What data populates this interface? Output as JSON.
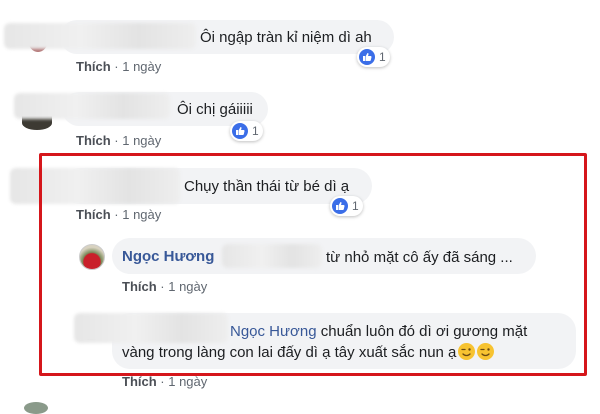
{
  "comments": [
    {
      "text": "Ôi ngập tràn kỉ niệm dì ah",
      "like_label": "Thích",
      "time": "1 ngày",
      "reactions": "1"
    },
    {
      "text": "Ôi chị gáiiiii",
      "like_label": "Thích",
      "time": "1 ngày",
      "reactions": "1"
    },
    {
      "text": "Chụy thần thái từ bé dì ạ",
      "like_label": "Thích",
      "time": "1 ngày",
      "reactions": "1"
    }
  ],
  "reply1": {
    "name": "Ngọc Hương",
    "text": "từ nhỏ mặt cô ấy đã sáng ...",
    "like_label": "Thích",
    "time": "1 ngày"
  },
  "reply2": {
    "mention": "Ngọc Hương",
    "text_line1": " chuẩn luôn đó dì ơi gương mặt",
    "text_line2": "vàng trong làng con lai đấy dì ạ tây xuất sắc nun ạ",
    "like_label": "Thích",
    "time": "1 ngày"
  },
  "colors": {
    "highlight": "#d5161b",
    "link": "#385898",
    "like_blue": "#3b6ee8",
    "bubble": "#f2f3f5"
  },
  "icons": {
    "reaction": "thumbs-up-icon",
    "emoji": "wink-emoji-icon"
  }
}
